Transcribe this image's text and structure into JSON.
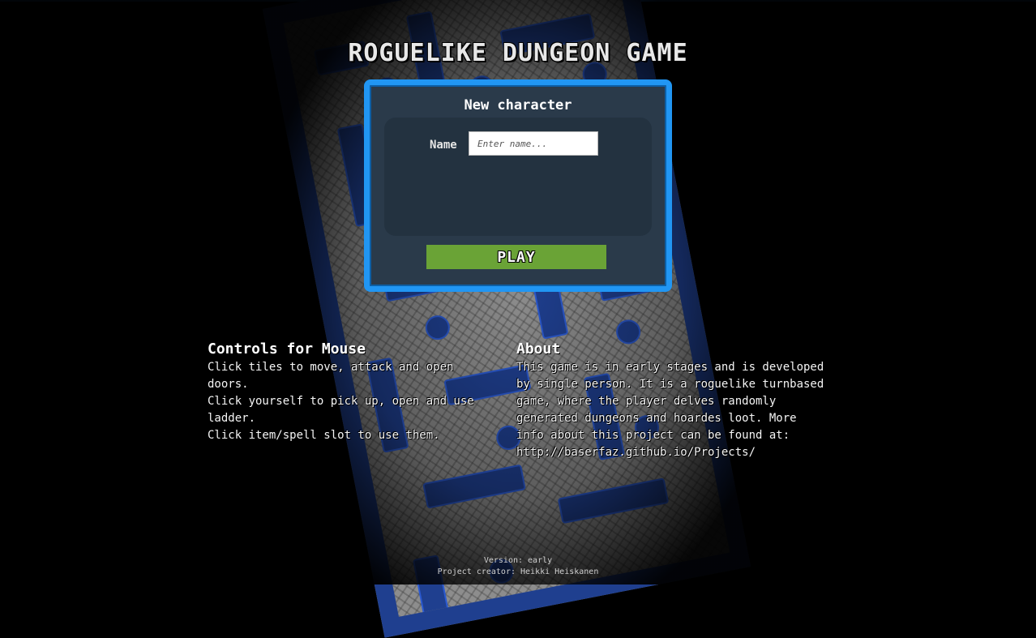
{
  "game": {
    "title": "ROGUELIKE DUNGEON GAME"
  },
  "new_character": {
    "heading": "New character",
    "name_label": "Name",
    "name_value": "",
    "name_placeholder": "Enter name...",
    "play_label": "PLAY"
  },
  "controls": {
    "heading": "Controls for Mouse",
    "lines": [
      "Click tiles to move, attack and open doors.",
      "Click yourself to pick up, open and use ladder.",
      "Click item/spell slot to use them."
    ]
  },
  "about": {
    "heading": "About",
    "text": "This game is in early stages and is developed by single person. It is a roguelike turnbased game, where the player delves randomly generated dungeons and hoardes loot. More info about this project can be found at:",
    "link": "http://baserfaz.github.io/Projects/"
  },
  "footer": {
    "version": "Version: early",
    "creator": "Project creator: Heikki Heiskanen"
  },
  "colors": {
    "panel_border": "#2196f3",
    "panel_bg": "#2a3a4a",
    "play_button": "#6aa336",
    "dungeon_wall": "#1f3f8f"
  }
}
